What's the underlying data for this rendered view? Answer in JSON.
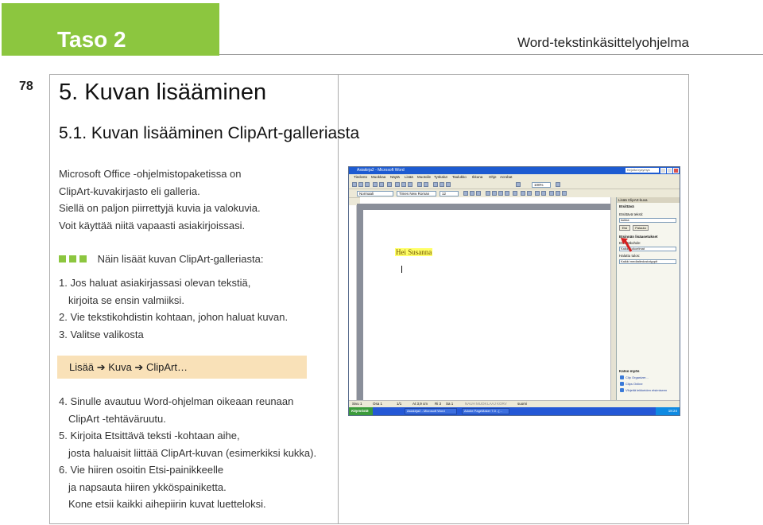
{
  "header": {
    "level": "Taso 2",
    "book_title": "Word-tekstinkäsittelyohjelma",
    "page_number": "78"
  },
  "content": {
    "heading": "5. Kuvan lisääminen",
    "subheading": "5.1. Kuvan lisääminen ClipArt-galleriasta",
    "intro": [
      "Microsoft Office -ohjelmistopaketissa on",
      "ClipArt-kuvakirjasto eli galleria.",
      "Siellä on paljon piirrettyjä kuvia ja valokuvia.",
      "Voit käyttää niitä vapaasti asiakirjoissasi."
    ],
    "howto_title": "Näin lisäät kuvan ClipArt-galleriasta:",
    "steps_a": [
      {
        "text": "1. Jos haluat asiakirjassasi olevan tekstiä,",
        "indent": false
      },
      {
        "text": "kirjoita se ensin valmiiksi.",
        "indent": true
      },
      {
        "text": "2. Vie tekstikohdistin kohtaan, johon haluat kuvan.",
        "indent": false
      },
      {
        "text": "3. Valitse valikosta",
        "indent": false
      }
    ],
    "menu_path": "Lisää ➔ Kuva ➔ ClipArt…",
    "steps_b": [
      {
        "text": "4. Sinulle avautuu Word-ohjelman oikeaan reunaan",
        "indent": false
      },
      {
        "text": "ClipArt -tehtäväruutu.",
        "indent": true
      },
      {
        "text": "5. Kirjoita Etsittävä teksti -kohtaan aihe,",
        "indent": false
      },
      {
        "text": "josta haluaisit liittää ClipArt-kuvan (esimerkiksi kukka).",
        "indent": true
      },
      {
        "text": "6. Vie hiiren osoitin Etsi-painikkeelle",
        "indent": false
      },
      {
        "text": "ja napsauta hiiren ykköspainiketta.",
        "indent": true
      },
      {
        "text": "Kone etsii kaikki aihepiirin kuvat luetteloksi.",
        "indent": true
      }
    ]
  },
  "screenshot": {
    "window_title": "Asiakirja2 - Microsoft Word",
    "help_box": "Kirjoita kysymys",
    "menu": [
      "Tiedosto",
      "Muokkaa",
      "Näytä",
      "Lisää",
      "Muotoile",
      "Työkalut",
      "Taulukko",
      "Ikkuna",
      "Ohje",
      "Acrobat"
    ],
    "style_combo": "Normaali",
    "font_combo": "Times New Roman",
    "size_combo": "12",
    "zoom_combo": "100%",
    "document_text": "Hei Susanna",
    "pane": {
      "title": "Lisää ClipArt-kuva",
      "search_section": "Etsittävä",
      "search_label": "Etsittävä teksti:",
      "search_value": "kukka",
      "search_button": "Etsi",
      "restore_button": "Palauta",
      "advanced_section": "Etsinnän lisäasetukset",
      "where_label": "Etsintäkohde:",
      "where_value": "Kaikki kokoelmat",
      "results_label": "Haluttu tulos:",
      "results_value": "Kaikki mediatiedostotyypit",
      "see_also": "Katso myös",
      "links": [
        "Clip Organizer...",
        "Clips Online",
        "Vihjeitä leikkeiden etsimiseen"
      ]
    },
    "status": [
      "Sivu 1",
      "Osa 1",
      "1/1",
      "At 3,9 cm",
      "Ri 3",
      "Sa 1",
      "NAUH",
      "MUOK",
      "LAAJ",
      "KORV",
      "suomi"
    ],
    "taskbar": {
      "start": "Käynnistä",
      "tasks": [
        "Asiakirja2 - Microsoft Word",
        "Adobe PageMaker 7.0 - [..."
      ],
      "clock": "18:24"
    }
  }
}
